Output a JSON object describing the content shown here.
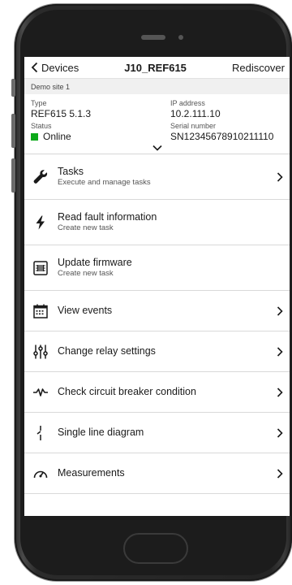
{
  "nav": {
    "back_label": "Devices",
    "title": "J10_REF615",
    "action_label": "Rediscover"
  },
  "site": {
    "name": "Demo site 1"
  },
  "device": {
    "type_label": "Type",
    "type_value": "REF615  5.1.3",
    "ip_label": "IP address",
    "ip_value": "10.2.111.10",
    "status_label": "Status",
    "status_value": "Online",
    "status_color": "#0ca919",
    "serial_label": "Serial number",
    "serial_value": "SN12345678910211110"
  },
  "actions": [
    {
      "icon": "wrench-icon",
      "title": "Tasks",
      "subtitle": "Execute and manage tasks",
      "has_chevron": true
    },
    {
      "icon": "lightning-icon",
      "title": "Read fault information",
      "subtitle": "Create new task",
      "has_chevron": false
    },
    {
      "icon": "chip-icon",
      "title": "Update firmware",
      "subtitle": "Create new task",
      "has_chevron": false
    },
    {
      "icon": "calendar-icon",
      "title": "View events",
      "subtitle": "",
      "has_chevron": true
    },
    {
      "icon": "sliders-icon",
      "title": "Change relay settings",
      "subtitle": "",
      "has_chevron": true
    },
    {
      "icon": "waveform-icon",
      "title": "Check circuit breaker condition",
      "subtitle": "",
      "has_chevron": true
    },
    {
      "icon": "single-line-icon",
      "title": "Single line diagram",
      "subtitle": "",
      "has_chevron": true
    },
    {
      "icon": "gauge-icon",
      "title": "Measurements",
      "subtitle": "",
      "has_chevron": true
    }
  ]
}
